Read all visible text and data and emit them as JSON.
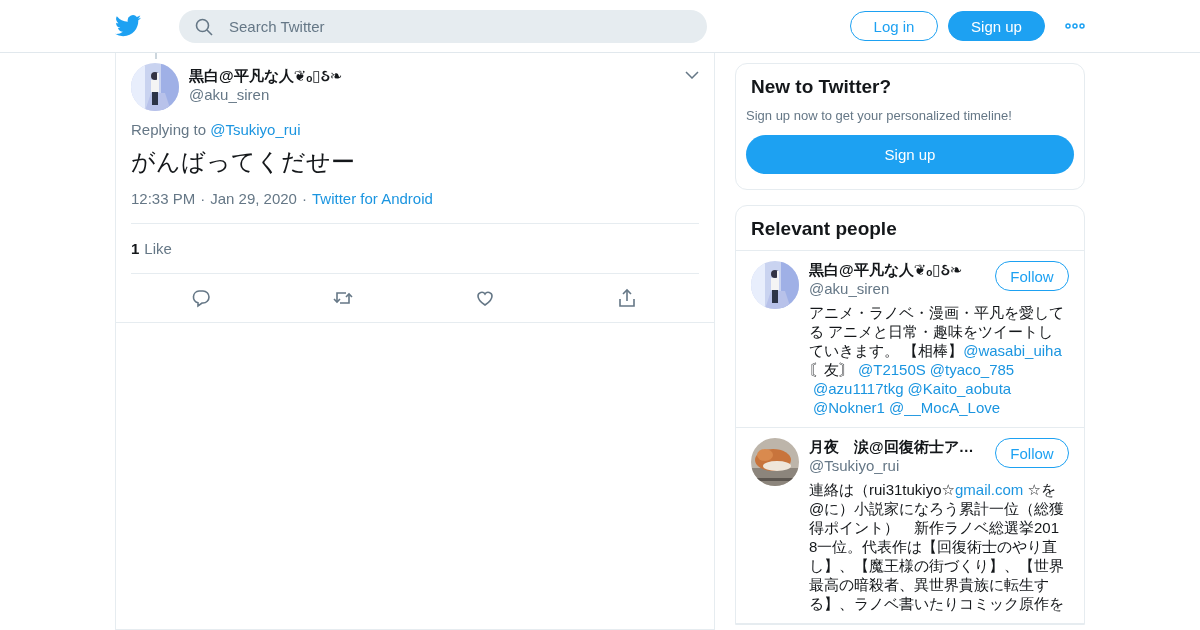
{
  "header": {
    "search": {
      "placeholder": "Search Twitter"
    },
    "login": "Log in",
    "signup": "Sign up"
  },
  "tweet": {
    "name": "黒白@平凡な人❦ₒ▯ઠ❧",
    "handle": "@aku_siren",
    "replying_prefix": "Replying to",
    "reply_to": "@Tsukiyo_rui",
    "text": "がんばってくだせー",
    "time": "12:33 PM",
    "separator": "·",
    "date": "Jan 29, 2020",
    "source": "Twitter for Android",
    "like_count": "1",
    "like_label": "Like"
  },
  "new_to_twitter": {
    "title": "New to Twitter?",
    "subtitle": "Sign up now to get your personalized timeline!",
    "button": "Sign up"
  },
  "relevant_people": {
    "title": "Relevant people",
    "people": [
      {
        "name": "黒白@平凡な人❦ₒ▯ઠ❧",
        "handle": "@aku_siren",
        "follow": "Follow",
        "bio": [
          {
            "kind": "text",
            "text": "アニメ・ラノベ・漫画・平凡を愛してる アニメと日常・趣味をツイートしていきます。 【相棒】"
          },
          {
            "kind": "link",
            "text": "@wasabi_uiha"
          },
          {
            "kind": "text",
            "text": "〘友〙"
          },
          {
            "kind": "link",
            "text": "@T2150S"
          },
          {
            "kind": "link",
            "text": "@tyaco_785"
          },
          {
            "kind": "link",
            "text": "@azu1117tkg"
          },
          {
            "kind": "link",
            "text": "@Kaito_aobuta"
          },
          {
            "kind": "link",
            "text": "@Nokner1"
          },
          {
            "kind": "link",
            "text": "@__MocA_Love"
          }
        ]
      },
      {
        "name": "月夜　涙@回復術士ア…",
        "handle": "@Tsukiyo_rui",
        "follow": "Follow",
        "bio": [
          {
            "kind": "text",
            "text": "連絡は（rui31tukiyo☆"
          },
          {
            "kind": "link",
            "text": "gmail.com"
          },
          {
            "kind": "text",
            "text": " ☆を@に）小説家になろう累計一位（総獲得ポイント）　新作ラノベ総選挙2018一位。代表作は【回復術士のやり直し】、【魔王様の街づくり】、【世界最高の暗殺者、異世界貴族に転生する】、ラノベ書いたりコミック原作を"
          }
        ]
      }
    ]
  }
}
